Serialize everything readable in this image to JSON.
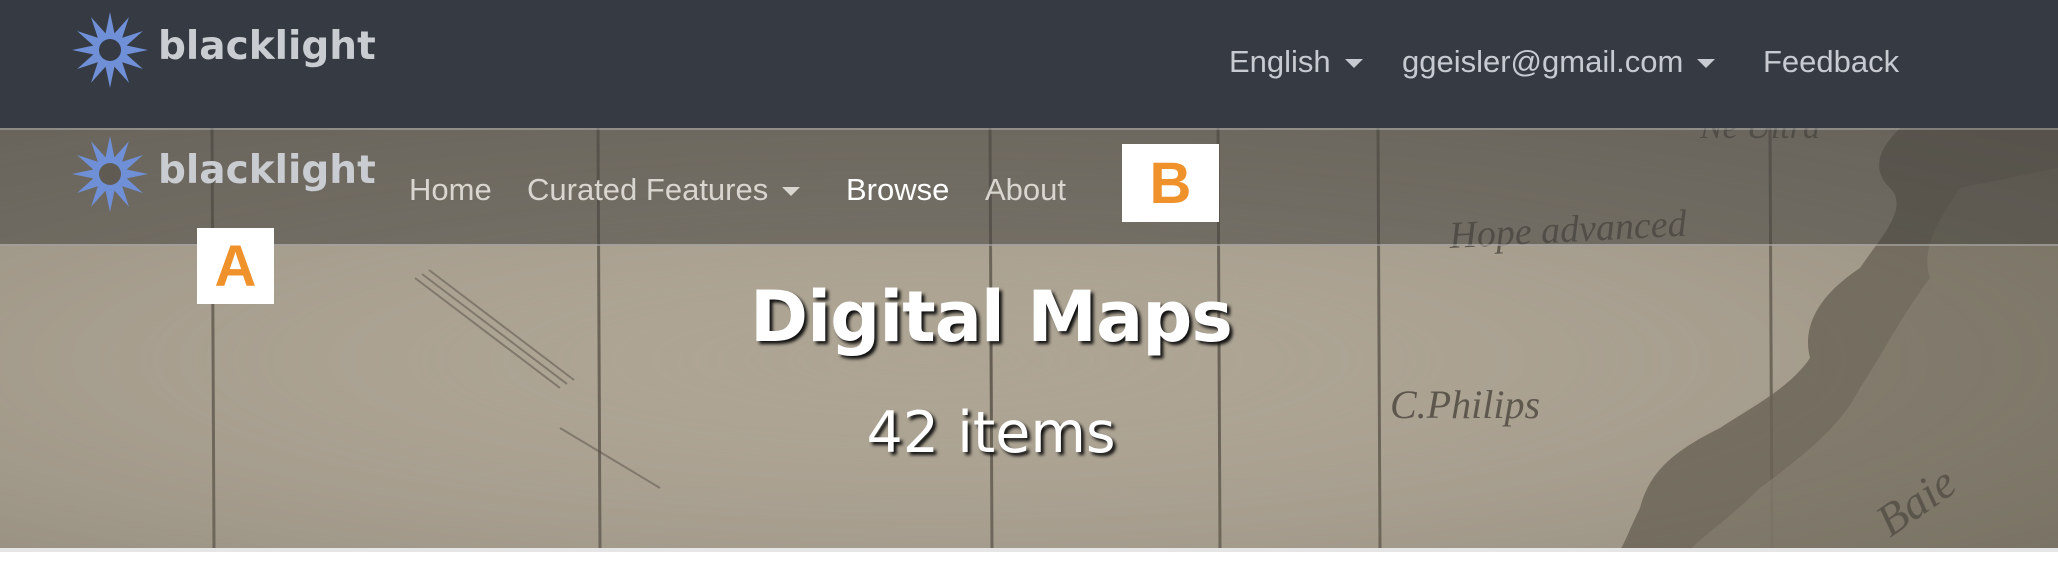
{
  "brand": {
    "logo_text": "blacklight",
    "icon": "blacklight-sun-icon"
  },
  "utility_nav": {
    "language_label": "English",
    "user_label": "ggeisler@gmail.com",
    "feedback_label": "Feedback"
  },
  "main_nav": {
    "items": [
      {
        "label": "Home",
        "active": false
      },
      {
        "label": "Curated Features",
        "active": false,
        "dropdown": true
      },
      {
        "label": "Browse",
        "active": true
      },
      {
        "label": "About",
        "active": false
      }
    ]
  },
  "markers": {
    "a": "A",
    "b": "B"
  },
  "hero": {
    "title": "Digital Maps",
    "count": "42 items"
  },
  "colors": {
    "topbar_bg": "#353a43",
    "marker_text": "#f0922b",
    "logo_blue": "#6f8fd6"
  }
}
